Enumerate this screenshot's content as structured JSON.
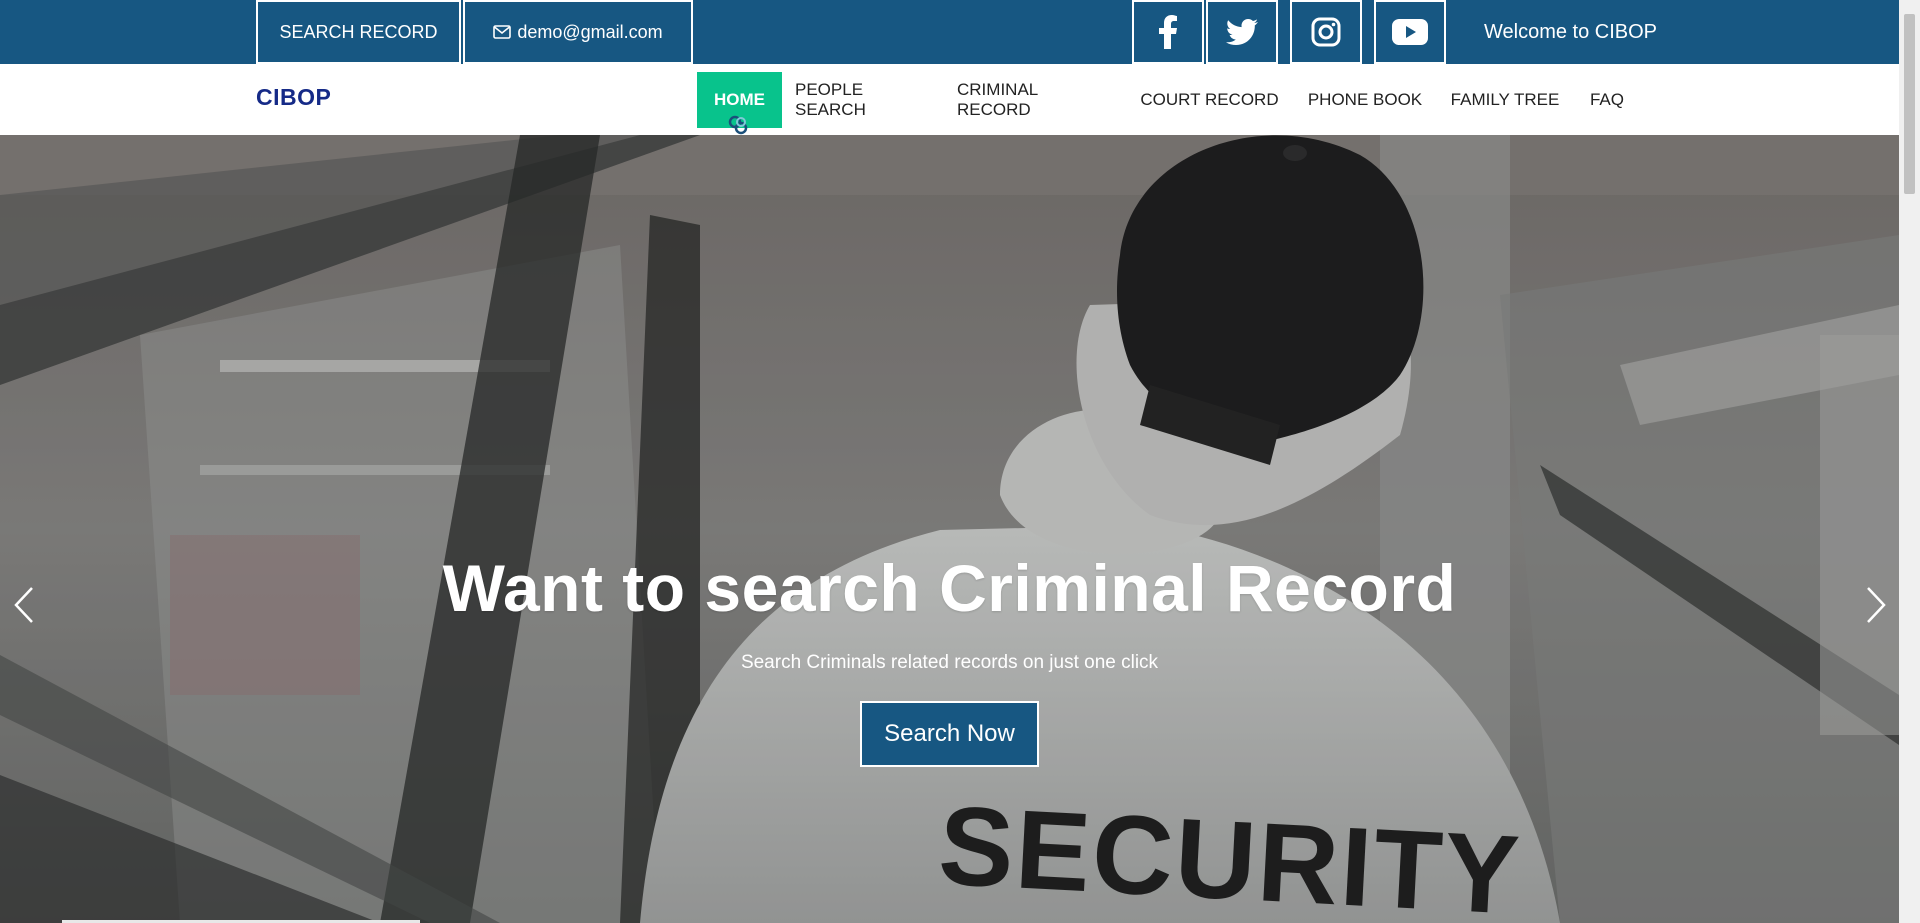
{
  "topbar": {
    "search_record": "SEARCH RECORD",
    "email": "demo@gmail.com",
    "social": [
      "facebook-icon",
      "twitter-icon",
      "instagram-icon",
      "youtube-icon"
    ],
    "welcome": "Welcome to CIBOP",
    "bg_color": "#175782"
  },
  "nav": {
    "brand": "CIBOP",
    "items": [
      "HOME",
      "PEOPLE SEARCH",
      "CRIMINAL RECORD",
      "COURT RECORD",
      "PHONE BOOK",
      "FAMILY TREE",
      "FAQ"
    ],
    "active_color": "#08c38c"
  },
  "hero": {
    "title": "Want to search Criminal Record",
    "subtitle": "Search Criminals related records on just one click",
    "button": "Search Now",
    "prev_icon": "chevron-left-icon",
    "next_icon": "chevron-right-icon"
  }
}
